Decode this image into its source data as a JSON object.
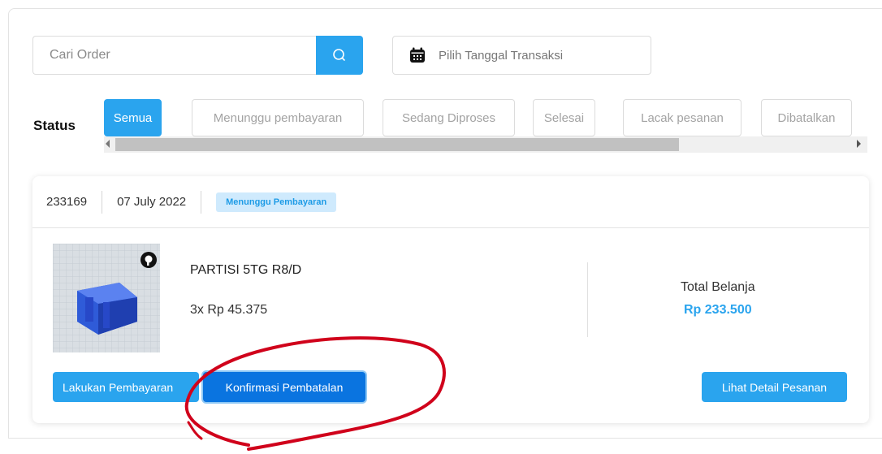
{
  "search": {
    "placeholder": "Cari Order",
    "button_icon": "search-icon"
  },
  "date_filter": {
    "icon": "calendar-icon",
    "label": "Pilih Tanggal Transaksi"
  },
  "status": {
    "label": "Status",
    "tabs": [
      {
        "label": "Semua",
        "active": true
      },
      {
        "label": "Menunggu pembayaran",
        "active": false
      },
      {
        "label": "Sedang Diproses",
        "active": false
      },
      {
        "label": "Selesai",
        "active": false
      },
      {
        "label": "Lacak pesanan",
        "active": false
      },
      {
        "label": "Dibatalkan",
        "active": false
      }
    ]
  },
  "order": {
    "id": "233169",
    "date": "07 July 2022",
    "status_badge": "Menunggu Pembayaran",
    "product": {
      "name": "PARTISI 5TG R8/D",
      "qty_price": "3x Rp 45.375"
    },
    "total_label": "Total Belanja",
    "total_value": "Rp 233.500",
    "actions": {
      "pay": "Lakukan Pembayaran",
      "cancel_confirm": "Konfirmasi Pembatalan",
      "detail": "Lihat Detail Pesanan"
    }
  },
  "colors": {
    "accent": "#2aa4ee",
    "accent_dark": "#0a74e0",
    "badge_bg": "#cfeafd",
    "annotation": "#d0021b"
  }
}
